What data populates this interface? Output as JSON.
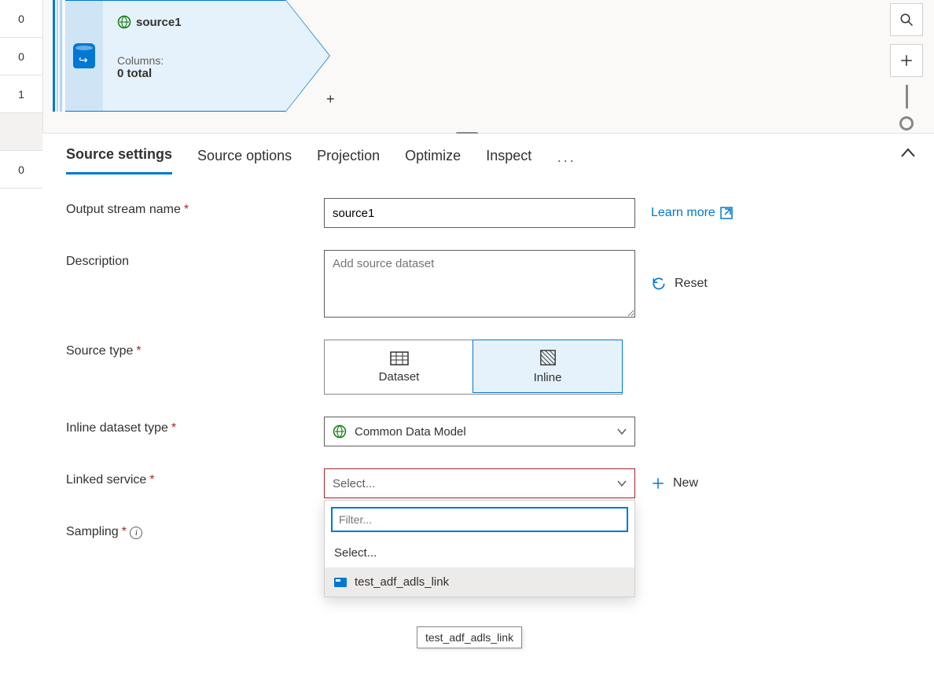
{
  "rail": {
    "counters": [
      "0",
      "0",
      "1",
      "0"
    ]
  },
  "node": {
    "title": "source1",
    "columns_label": "Columns:",
    "columns_total": "0 total"
  },
  "tabs": {
    "items": [
      "Source settings",
      "Source options",
      "Projection",
      "Optimize",
      "Inspect"
    ],
    "more": "···"
  },
  "form": {
    "output_stream_label": "Output stream name",
    "output_stream_value": "source1",
    "description_label": "Description",
    "description_placeholder": "Add source dataset",
    "source_type_label": "Source type",
    "source_type_options": {
      "dataset": "Dataset",
      "inline": "Inline"
    },
    "inline_type_label": "Inline dataset type",
    "inline_type_value": "Common Data Model",
    "linked_service_label": "Linked service",
    "linked_service_placeholder": "Select...",
    "sampling_label": "Sampling",
    "new_label": "New",
    "learn_more": "Learn more",
    "reset_label": "Reset"
  },
  "dropdown": {
    "filter_placeholder": "Filter...",
    "select_label": "Select...",
    "option_label": "test_adf_adls_link"
  },
  "tooltip": "test_adf_adls_link"
}
